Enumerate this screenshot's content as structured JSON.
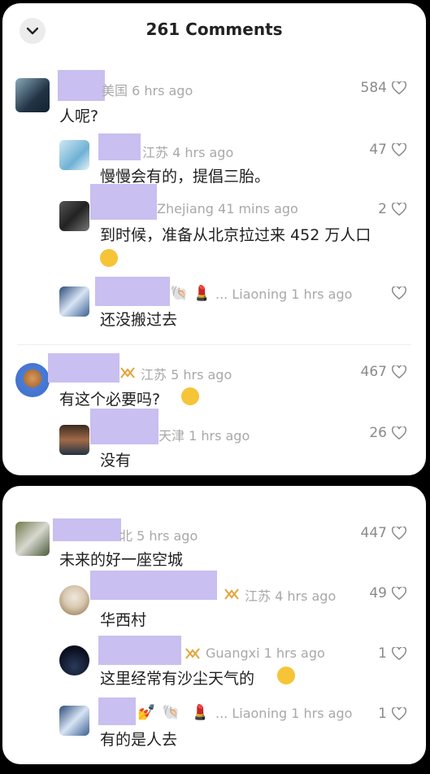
{
  "header": {
    "title": "261 Comments"
  },
  "comments": [
    {
      "meta": "美国 6 hrs ago",
      "likes": "584",
      "text": "人呢?"
    },
    {
      "meta": "江苏 4 hrs ago",
      "likes": "47",
      "text": "慢慢会有的，提倡三胎。"
    },
    {
      "meta": "Zhejiang 41 mins ago",
      "likes": "2",
      "text": "到时候，准备从北京拉过来 452 万人口"
    },
    {
      "meta": "... Liaoning 1 hrs ago",
      "likes": "",
      "text": "还没搬过去"
    },
    {
      "meta": "江苏 5 hrs ago",
      "likes": "467",
      "text": "有这个必要吗?"
    },
    {
      "meta": "天津 1 hrs ago",
      "likes": "26",
      "text": "没有"
    },
    {
      "meta": "北 5 hrs ago",
      "likes": "447",
      "text": "未来的好一座空城"
    },
    {
      "meta": "江苏 4 hrs ago",
      "likes": "49",
      "text": "华西村"
    },
    {
      "meta": "Guangxi 1 hrs ago",
      "likes": "1",
      "text": "这里经常有沙尘天气的"
    },
    {
      "meta": "... Liaoning 1 hrs ago",
      "likes": "1",
      "text": "有的是人去"
    }
  ]
}
